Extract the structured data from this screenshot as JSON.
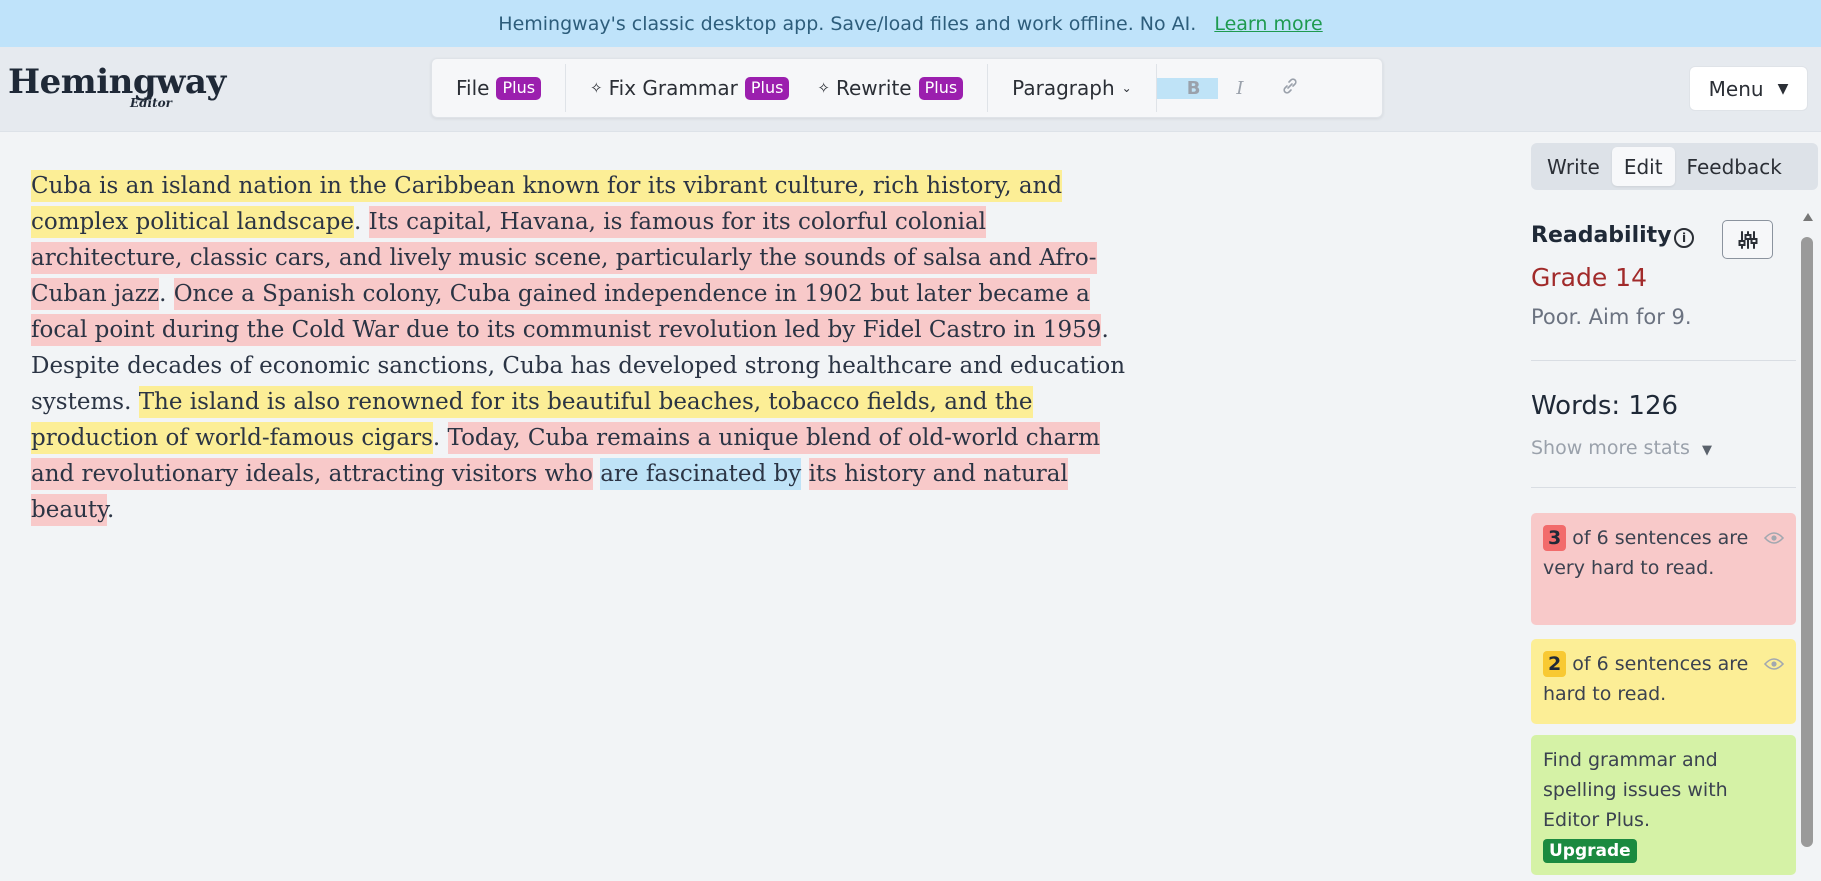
{
  "banner": {
    "text": "Hemingway's classic desktop app. Save/load files and work offline. No AI.",
    "link": "Learn more"
  },
  "logo": {
    "main": "Hemingway",
    "sub": "Editor"
  },
  "toolbar": {
    "file": "File",
    "fix_grammar": "Fix Grammar",
    "rewrite": "Rewrite",
    "plus_badge": "Plus",
    "paragraph": "Paragraph",
    "bold": "B",
    "italic": "I"
  },
  "menu": {
    "label": "Menu"
  },
  "tabs": {
    "write": "Write",
    "edit": "Edit",
    "feedback": "Feedback"
  },
  "editor": {
    "segments": [
      "Cuba is an island nation in the Caribbean known for its vibrant culture, rich history, and complex political landscape",
      ". ",
      "Its capital, Havana, is famous for its colorful colonial architecture, classic cars, and lively music scene, particularly the sounds of salsa and Afro-Cuban jazz",
      ". ",
      "Once a Spanish colony, Cuba gained independence in 1902 but later became a focal point during the Cold War due to its communist revolution led by Fidel Castro in 1959",
      ". Despite decades of economic sanctions, Cuba has developed strong healthcare and education systems. ",
      "The island is also renowned for its beautiful beaches, tobacco fields, and the production of world-famous cigars",
      ". ",
      "Today, Cuba remains a unique blend of old-world charm and revolutionary ideals, attracting visitors who",
      " ",
      "are fascinated by",
      " ",
      "its history and natural beauty",
      "."
    ]
  },
  "sidebar": {
    "readability_title": "Readability",
    "grade": "Grade 14",
    "aim": "Poor. Aim for 9.",
    "words": "Words: 126",
    "show_more": "Show more stats",
    "cards": {
      "very_hard_count": "3",
      "very_hard_text": "of 6 sentences are very hard to read.",
      "hard_count": "2",
      "hard_text": "of 6 sentences are hard to read.",
      "grammar_text": "Find grammar and spelling issues with Editor Plus.",
      "upgrade": "Upgrade"
    }
  },
  "colors": {
    "banner_bg": "#bfe3fa",
    "very_hard": "#f8c9c9",
    "hard": "#fcee96",
    "passive": "#bfe3f7",
    "plus_badge": "#9b1fae",
    "upgrade": "#1b8a40"
  },
  "icons": [
    "sparkle-icon",
    "chevron-down-icon",
    "link-icon",
    "info-icon",
    "sliders-icon",
    "eye-icon",
    "caret-down-icon"
  ]
}
